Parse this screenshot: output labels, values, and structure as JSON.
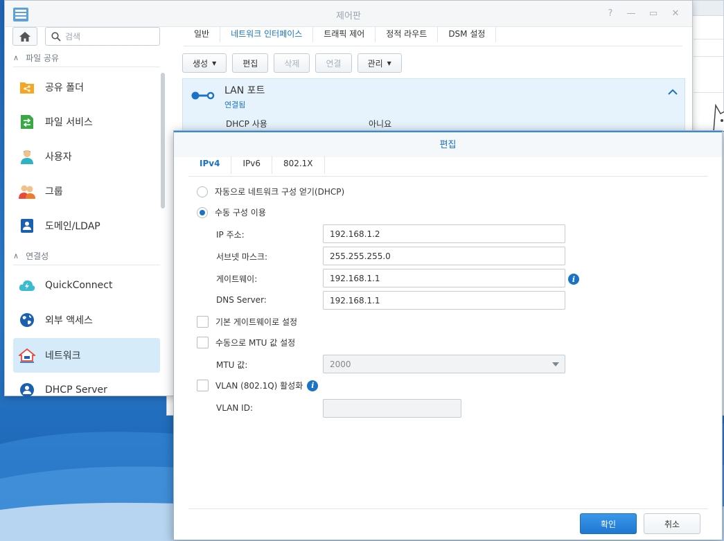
{
  "window": {
    "title": "제어판"
  },
  "sidebar": {
    "search_placeholder": "검색",
    "sections": [
      {
        "label": "파일 공유"
      },
      {
        "label": "연결성"
      }
    ],
    "items": [
      {
        "label": "공유 폴더"
      },
      {
        "label": "파일 서비스"
      },
      {
        "label": "사용자"
      },
      {
        "label": "그룹"
      },
      {
        "label": "도메인/LDAP"
      },
      {
        "label": "QuickConnect"
      },
      {
        "label": "외부 액세스"
      },
      {
        "label": "네트워크"
      },
      {
        "label": "DHCP Server"
      }
    ]
  },
  "main": {
    "tabs": [
      {
        "label": "일반"
      },
      {
        "label": "네트워크 인터페이스"
      },
      {
        "label": "트래픽 제어"
      },
      {
        "label": "정적 라우트"
      },
      {
        "label": "DSM 설정"
      }
    ],
    "toolbar": {
      "create": "생성",
      "edit": "편집",
      "delete": "삭제",
      "connect": "연결",
      "manage": "관리"
    },
    "lan": {
      "title": "LAN 포트",
      "status": "연결됨",
      "dhcp_key": "DHCP 사용",
      "dhcp_value": "아니요"
    }
  },
  "dialog": {
    "title": "편집",
    "tabs": [
      {
        "label": "IPv4"
      },
      {
        "label": "IPv6"
      },
      {
        "label": "802.1X"
      }
    ],
    "dhcp_option": "자동으로 네트워크 구성 얻기(DHCP)",
    "manual_option": "수동 구성 이용",
    "ip_label": "IP 주소:",
    "ip_value": "192.168.1.2",
    "subnet_label": "서브넷 마스크:",
    "subnet_value": "255.255.255.0",
    "gateway_label": "게이트웨이:",
    "gateway_value": "192.168.1.1",
    "dns_label": "DNS Server:",
    "dns_value": "192.168.1.1",
    "default_gateway_check": "기본 게이트웨이로 설정",
    "manual_mtu_check": "수동으로 MTU 값 설정",
    "mtu_label": "MTU 값:",
    "mtu_value": "2000",
    "vlan_check": "VLAN (802.1Q) 활성화",
    "vlan_id_label": "VLAN ID:",
    "vlan_id_value": "",
    "ok": "확인",
    "cancel": "취소"
  },
  "colors": {
    "accent": "#1a73c7",
    "selected_bg": "#d6ebfa",
    "desktop": "#2a7fd0"
  }
}
